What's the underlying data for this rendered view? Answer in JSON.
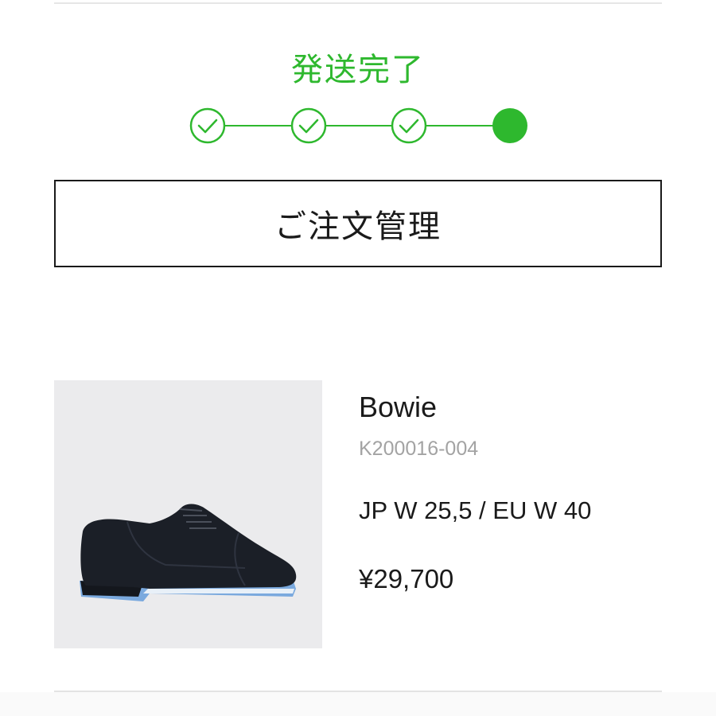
{
  "colors": {
    "accent": "#2eb82e",
    "text": "#1a1a1a",
    "muted": "#a3a3a3",
    "image_bg": "#ebebed",
    "divider": "#e6e6e6"
  },
  "order_status": {
    "title": "発送完了",
    "steps": [
      {
        "state": "completed",
        "icon": "check-circle-icon"
      },
      {
        "state": "completed",
        "icon": "check-circle-icon"
      },
      {
        "state": "completed",
        "icon": "check-circle-icon"
      },
      {
        "state": "current",
        "icon": "filled-circle-icon"
      }
    ]
  },
  "actions": {
    "manage_orders_label": "ご注文管理"
  },
  "product": {
    "name": "Bowie",
    "code": "K200016-004",
    "size": "JP W 25,5 / EU W 40",
    "price": "¥29,700",
    "image": "black-suede-oxford-shoe-with-blue-sole"
  }
}
